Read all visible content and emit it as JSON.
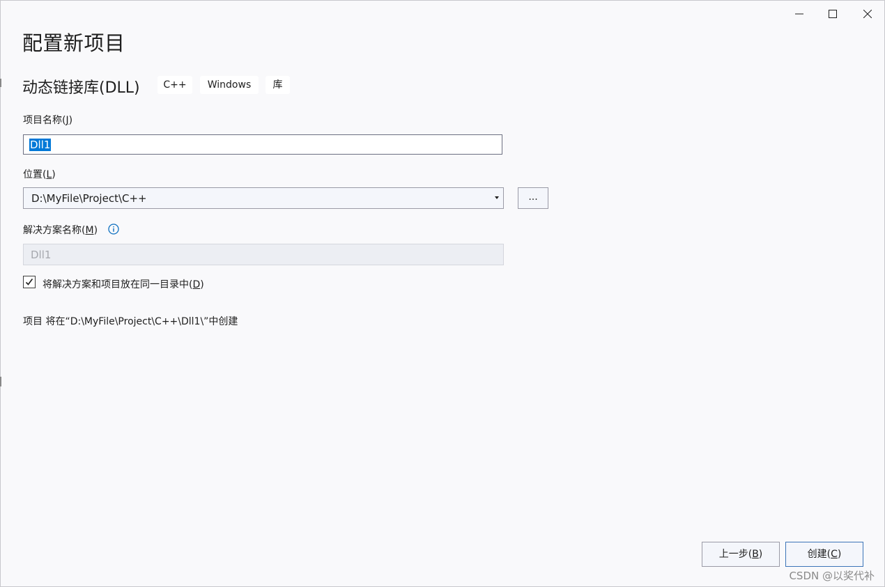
{
  "window_controls": {
    "minimize_icon": "minimize-icon",
    "maximize_icon": "maximize-icon",
    "close_icon": "close-icon"
  },
  "header": {
    "title": "配置新项目",
    "template_name": "动态链接库(DLL)",
    "tags": [
      "C++",
      "Windows",
      "库"
    ]
  },
  "project_name": {
    "label_text": "项目名称(",
    "label_key": "J",
    "label_end": ")",
    "value": "Dll1"
  },
  "location": {
    "label_text": "位置(",
    "label_key": "L",
    "label_end": ")",
    "value": "D:\\MyFile\\Project\\C++",
    "browse_label": "..."
  },
  "solution_name": {
    "label_text": "解决方案名称(",
    "label_key": "M",
    "label_end": ")",
    "value": "Dll1",
    "info_icon": "info-icon"
  },
  "same_dir_checkbox": {
    "checked": true,
    "label_text": "将解决方案和项目放在同一目录中(",
    "label_key": "D",
    "label_end": ")"
  },
  "creation_info": "项目 将在“D:\\MyFile\\Project\\C++\\Dll1\\”中创建",
  "footer": {
    "back_text": "上一步(",
    "back_key": "B",
    "back_end": ")",
    "create_text": "创建(",
    "create_key": "C",
    "create_end": ")"
  },
  "watermark": "CSDN @以奖代补",
  "colors": {
    "accent": "#0078d7",
    "primary_border": "#3c74b8",
    "window_bg": "#f9f9fb"
  }
}
